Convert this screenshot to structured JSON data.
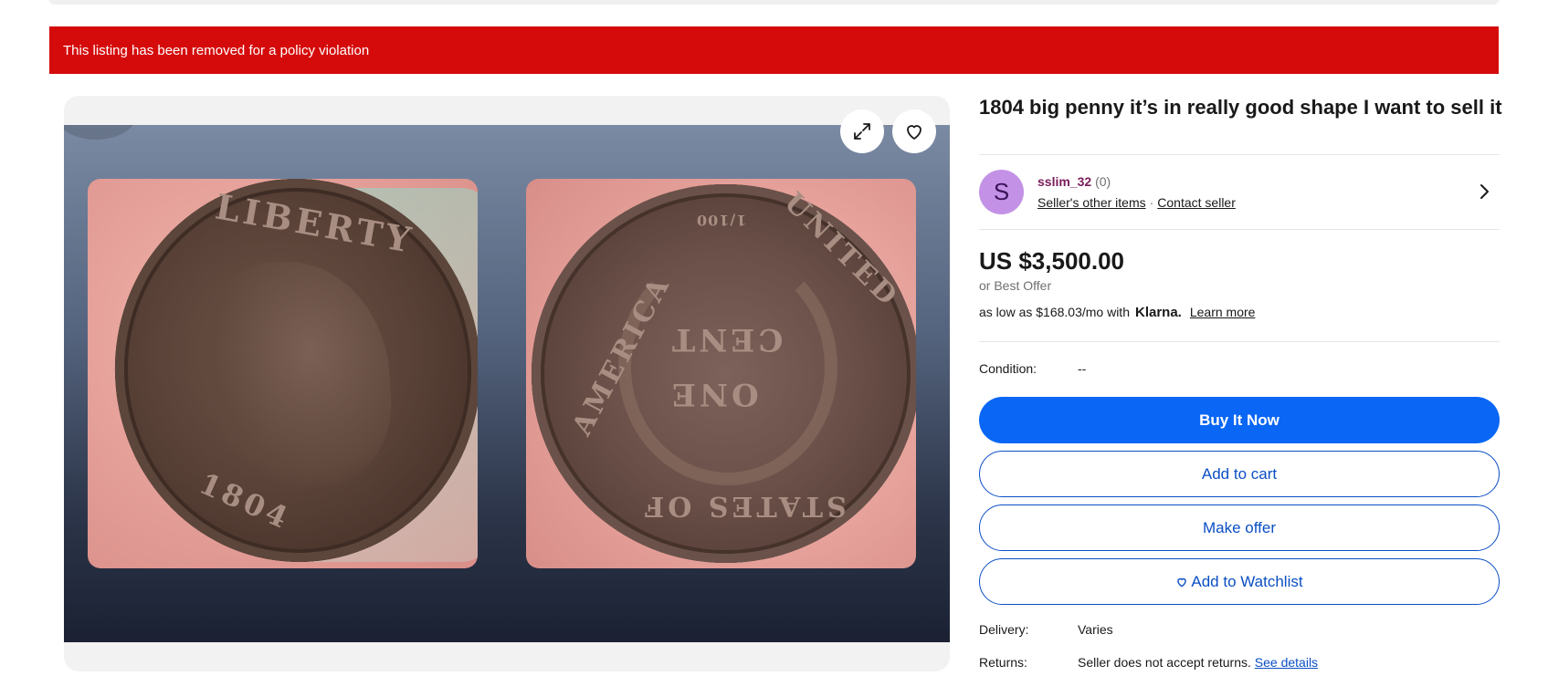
{
  "alert": {
    "message": "This listing has been removed for a policy violation"
  },
  "gallery": {
    "expand_icon": "expand-arrows-icon",
    "heart_icon": "heart-icon",
    "coin_obverse": {
      "legend": "LIBERTY",
      "date": "1804"
    },
    "coin_reverse": {
      "top": "UNITED",
      "left": "AMERICA",
      "bottom": "STATES OF",
      "center_top": "CENT",
      "center_bottom": "ONE",
      "fraction": "1/100"
    }
  },
  "listing": {
    "title": "1804 big penny it’s in really good shape I want to sell it"
  },
  "seller": {
    "avatar_letter": "S",
    "name": "sslim_32",
    "feedback": "(0)",
    "other_items": "Seller's other items",
    "separator": "·",
    "contact": "Contact seller",
    "chevron_icon": "chevron-right-icon"
  },
  "pricing": {
    "price": "US $3,500.00",
    "best_offer": "or Best Offer",
    "klarna_prefix": "as low as $168.03/mo with",
    "klarna_brand": "Klarna.",
    "learn_more": "Learn more"
  },
  "condition": {
    "label": "Condition:",
    "value": "--"
  },
  "actions": {
    "buy_now": "Buy It Now",
    "add_to_cart": "Add to cart",
    "make_offer": "Make offer",
    "watchlist": "Add to Watchlist"
  },
  "shipping": {
    "delivery_label": "Delivery:",
    "delivery_value": "Varies",
    "returns_label": "Returns:",
    "returns_value": "Seller does not accept returns.",
    "returns_link": "See details"
  },
  "colors": {
    "alert_bg": "#d50b0b",
    "primary": "#0a66f4",
    "link": "#0a4fc4",
    "seller_name": "#7a1d5b",
    "avatar": "#c392e6"
  }
}
